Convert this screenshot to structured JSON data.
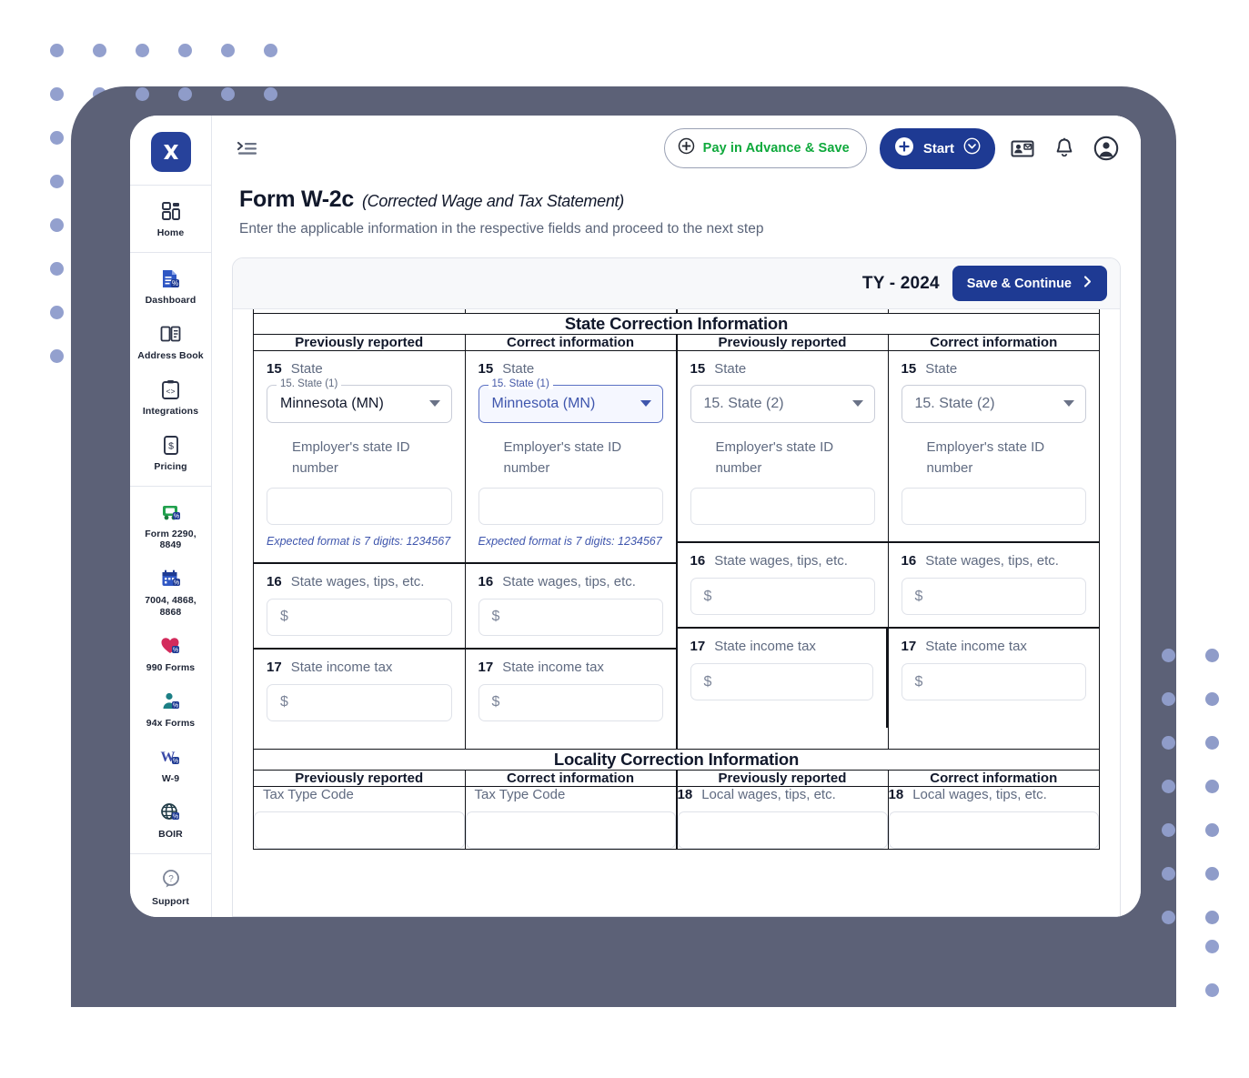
{
  "brand": {
    "logo_icon": "taxbandits-x-logo",
    "accent": "#1e3a93",
    "green": "#0fa93c",
    "frame_color": "#5c6177",
    "dot_color": "#93a0ce"
  },
  "topbar": {
    "collapse_icon": "collapse-menu-icon",
    "pay_in_advance": {
      "label": "Pay in Advance & Save",
      "icon": "plus-circle-icon"
    },
    "start": {
      "label": "Start",
      "icon": "plus-circle-icon",
      "caret_icon": "chevron-down-circle-icon"
    },
    "contact_card_icon": "contact-card-icon",
    "notification_icon": "bell-icon",
    "account_icon": "user-avatar-icon"
  },
  "sidebar": {
    "groups": [
      {
        "items": [
          {
            "label": "Home",
            "icon": "grid-dashboard-icon"
          }
        ]
      },
      {
        "items": [
          {
            "label": "Dashboard",
            "icon": "document-tax-icon"
          },
          {
            "label": "Address Book",
            "icon": "address-book-icon"
          },
          {
            "label": "Integrations",
            "icon": "code-brackets-icon"
          },
          {
            "label": "Pricing",
            "icon": "dollar-tag-icon"
          }
        ]
      },
      {
        "items": [
          {
            "label": "Form 2290, 8849",
            "icon": "truck-icon"
          },
          {
            "label": "7004, 4868, 8868",
            "icon": "calendar-icon"
          },
          {
            "label": "990 Forms",
            "icon": "heart-icon"
          },
          {
            "label": "94x Forms",
            "icon": "person-tax-icon"
          },
          {
            "label": "W-9",
            "icon": "w9-icon"
          },
          {
            "label": "BOIR",
            "icon": "globe-icon"
          }
        ]
      },
      {
        "items": [
          {
            "label": "Support",
            "icon": "question-balloon-icon"
          }
        ]
      }
    ]
  },
  "page": {
    "title": "Form W-2c",
    "title_sub": "(Corrected Wage and Tax Statement)",
    "description": "Enter the applicable information in the respective fields and proceed to the next step"
  },
  "card": {
    "tax_year": "TY - 2024",
    "save_label": "Save & Continue",
    "save_icon": "chevron-right-icon"
  },
  "state_section": {
    "title": "State Correction Information",
    "column_headers": [
      "Previously reported",
      "Correct information",
      "Previously reported",
      "Correct information"
    ],
    "left_pair": [
      {
        "state": {
          "num": "15",
          "label": "State",
          "legend": "15. State (1)",
          "value": "Minnesota (MN)",
          "active": false
        },
        "employer_id": {
          "label": "Employer's state ID number",
          "value": "",
          "hint": "Expected format is 7 digits: 1234567"
        },
        "wages": {
          "num": "16",
          "label": "State wages, tips, etc.",
          "prefix": "$",
          "value": ""
        },
        "tax": {
          "num": "17",
          "label": "State income tax",
          "prefix": "$",
          "value": ""
        }
      },
      {
        "state": {
          "num": "15",
          "label": "State",
          "legend": "15. State (1)",
          "value": "Minnesota (MN)",
          "active": true
        },
        "employer_id": {
          "label": "Employer's state ID number",
          "value": "",
          "hint": "Expected format is 7 digits: 1234567"
        },
        "wages": {
          "num": "16",
          "label": "State wages, tips, etc.",
          "prefix": "$",
          "value": ""
        },
        "tax": {
          "num": "17",
          "label": "State income tax",
          "prefix": "$",
          "value": ""
        }
      }
    ],
    "right_pair": [
      {
        "state": {
          "num": "15",
          "label": "State",
          "legend": "",
          "value": "15. State (2)",
          "active": false,
          "placeholder": true
        },
        "employer_id": {
          "label": "Employer's state ID number",
          "value": "",
          "hint": ""
        },
        "wages": {
          "num": "16",
          "label": "State wages, tips, etc.",
          "prefix": "$",
          "value": ""
        },
        "tax": {
          "num": "17",
          "label": "State income tax",
          "prefix": "$",
          "value": ""
        }
      },
      {
        "state": {
          "num": "15",
          "label": "State",
          "legend": "",
          "value": "15. State (2)",
          "active": false,
          "placeholder": true
        },
        "employer_id": {
          "label": "Employer's state ID number",
          "value": "",
          "hint": ""
        },
        "wages": {
          "num": "16",
          "label": "State wages, tips, etc.",
          "prefix": "$",
          "value": ""
        },
        "tax": {
          "num": "17",
          "label": "State income tax",
          "prefix": "$",
          "value": ""
        }
      }
    ]
  },
  "locality_section": {
    "title": "Locality Correction Information",
    "column_headers": [
      "Previously reported",
      "Correct information",
      "Previously reported",
      "Correct information"
    ],
    "cells": [
      {
        "num": "",
        "label": "Tax Type Code"
      },
      {
        "num": "",
        "label": "Tax Type Code"
      },
      {
        "num": "18",
        "label": "Local wages, tips, etc."
      },
      {
        "num": "18",
        "label": "Local wages, tips, etc."
      }
    ]
  }
}
